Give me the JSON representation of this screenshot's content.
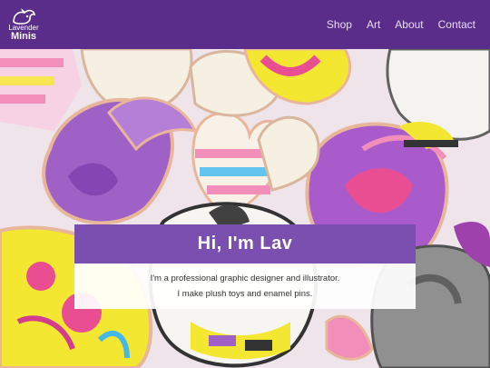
{
  "brand": {
    "line1": "Lavender",
    "line2": "Minis"
  },
  "nav": {
    "items": [
      {
        "label": "Shop"
      },
      {
        "label": "Art"
      },
      {
        "label": "About"
      },
      {
        "label": "Contact"
      }
    ]
  },
  "hero": {
    "title": "Hi, I'm Lav",
    "line1": "I'm a professional graphic designer and illustrator.",
    "line2": "I make plush toys and enamel pins."
  },
  "colors": {
    "header_bg": "#5a2d8a",
    "title_band": "#7b4fb0",
    "accent_pink": "#e9478f",
    "accent_yellow": "#f4e62a",
    "accent_blue": "#3fb6e8"
  },
  "icons": {
    "logo": "dragon-logo-icon"
  }
}
